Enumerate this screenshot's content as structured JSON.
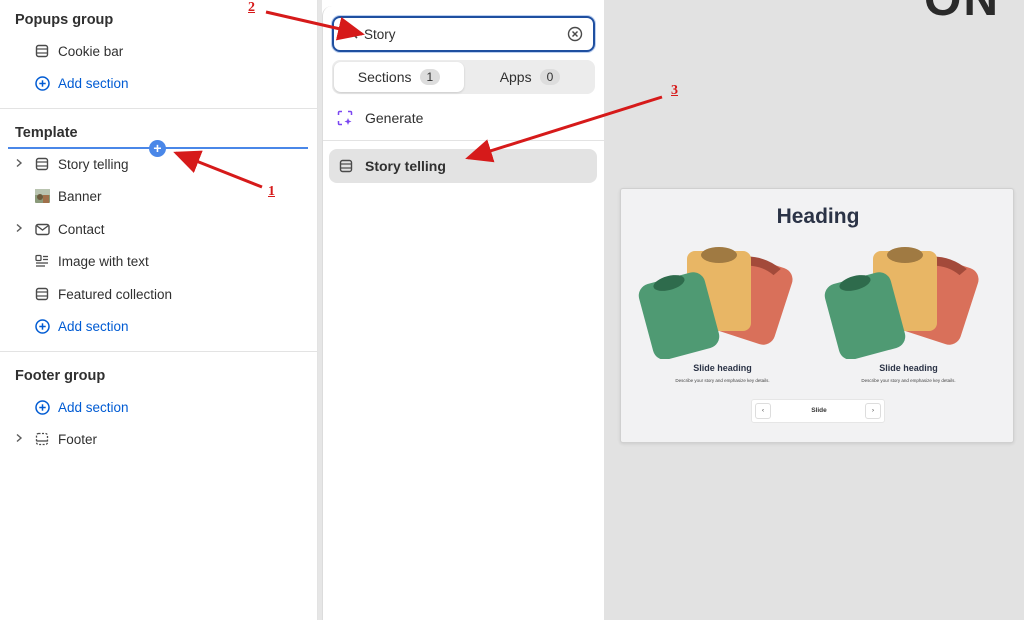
{
  "sidebar": {
    "popups_group": {
      "title": "Popups group",
      "items": [
        {
          "label": "Cookie bar",
          "icon": "section-icon"
        }
      ],
      "add_label": "Add section"
    },
    "template": {
      "title": "Template",
      "items": [
        {
          "label": "Story telling",
          "icon": "section-icon",
          "expandable": true
        },
        {
          "label": "Banner",
          "icon": "image-thumbnail",
          "expandable": false
        },
        {
          "label": "Contact",
          "icon": "envelope-icon",
          "expandable": true
        },
        {
          "label": "Image with text",
          "icon": "image-text-icon",
          "expandable": false
        },
        {
          "label": "Featured collection",
          "icon": "section-icon",
          "expandable": false
        }
      ],
      "add_label": "Add section"
    },
    "footer_group": {
      "title": "Footer group",
      "add_label": "Add section",
      "items": [
        {
          "label": "Footer",
          "icon": "footer-icon",
          "expandable": true
        }
      ]
    }
  },
  "picker": {
    "search": {
      "value": "Story"
    },
    "tabs": [
      {
        "label": "Sections",
        "count": "1",
        "active": true
      },
      {
        "label": "Apps",
        "count": "0",
        "active": false
      }
    ],
    "generate_label": "Generate",
    "results": [
      {
        "label": "Story telling",
        "icon": "section-icon"
      }
    ]
  },
  "preview": {
    "heading": "Heading",
    "top_text": "ON",
    "slides": [
      {
        "heading": "Slide heading",
        "description": "Describe your story and emphasize key details."
      },
      {
        "heading": "Slide heading",
        "description": "Describe your story and emphasize key details."
      }
    ],
    "control": {
      "label": "Slide",
      "prev": "‹",
      "next": "›"
    }
  },
  "annotations": [
    "1",
    "2",
    "3"
  ],
  "colors": {
    "accent_blue": "#005bd3",
    "insert_line": "#4a87e8",
    "annotation_red": "#d61a1a",
    "search_border": "#1f4fa0",
    "shirt_green": "#4f9a73",
    "shirt_yellow": "#e8b665",
    "shirt_red": "#d9705a"
  }
}
